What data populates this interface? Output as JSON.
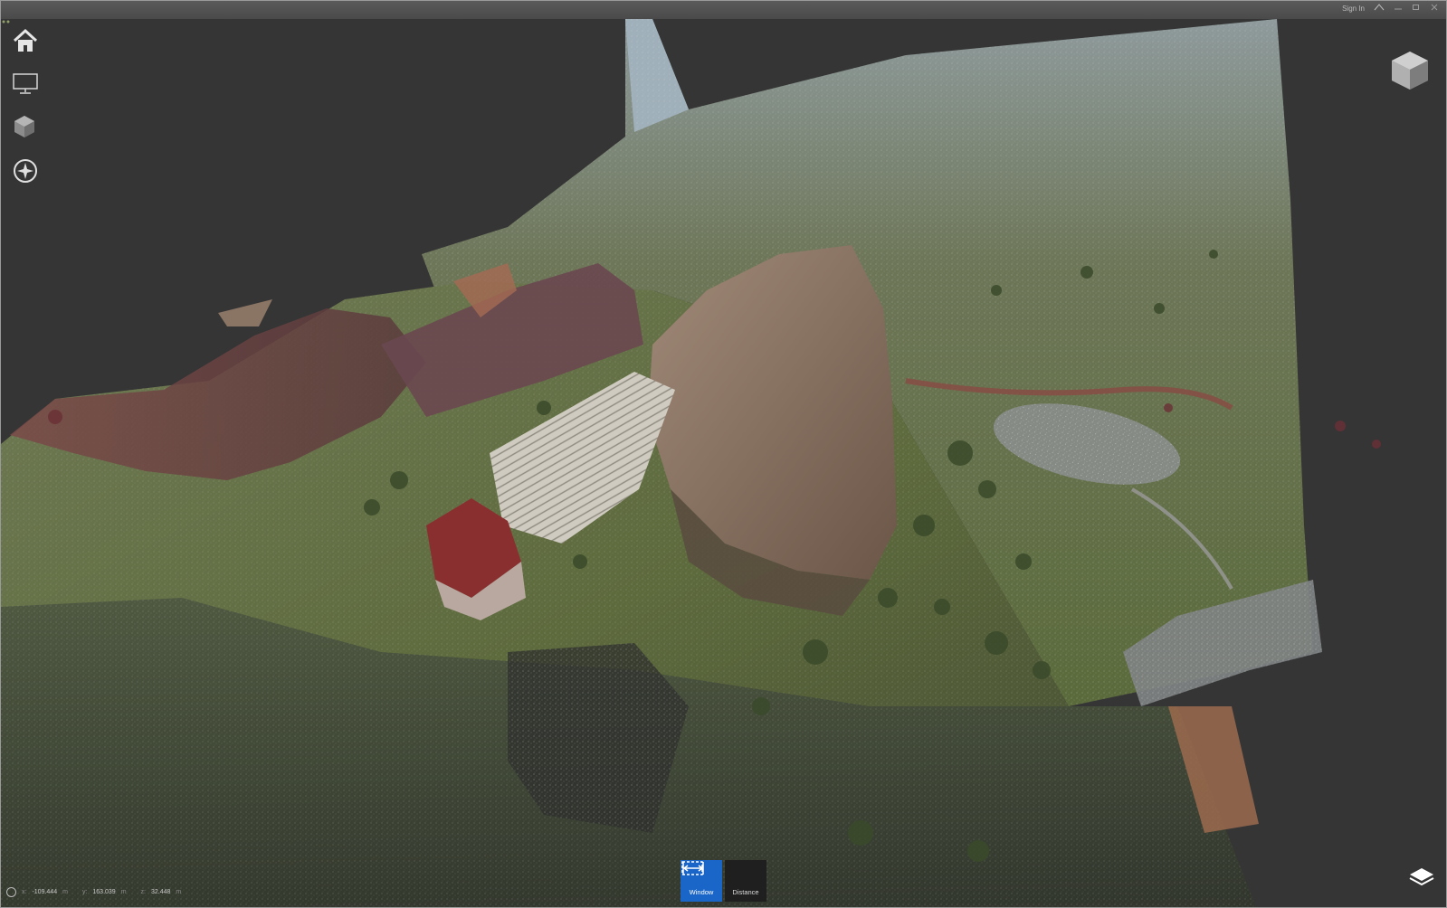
{
  "window": {
    "sign_in_label": "Sign In",
    "colors": {
      "frame": "#343434",
      "accent": "#1a66c8"
    }
  },
  "nav_tools": [
    {
      "name": "home-icon"
    },
    {
      "name": "presentation-icon"
    },
    {
      "name": "cube-icon"
    },
    {
      "name": "compass-icon"
    }
  ],
  "coordinates": {
    "x_label": "x:",
    "x": "-109.444",
    "x_unit": "m",
    "y_label": "y:",
    "y": "163.039",
    "y_unit": "m",
    "z_label": "z:",
    "z": "32.448",
    "z_unit": "m"
  },
  "toolbar": {
    "window_label": "Window",
    "distance_label": "Distance"
  }
}
